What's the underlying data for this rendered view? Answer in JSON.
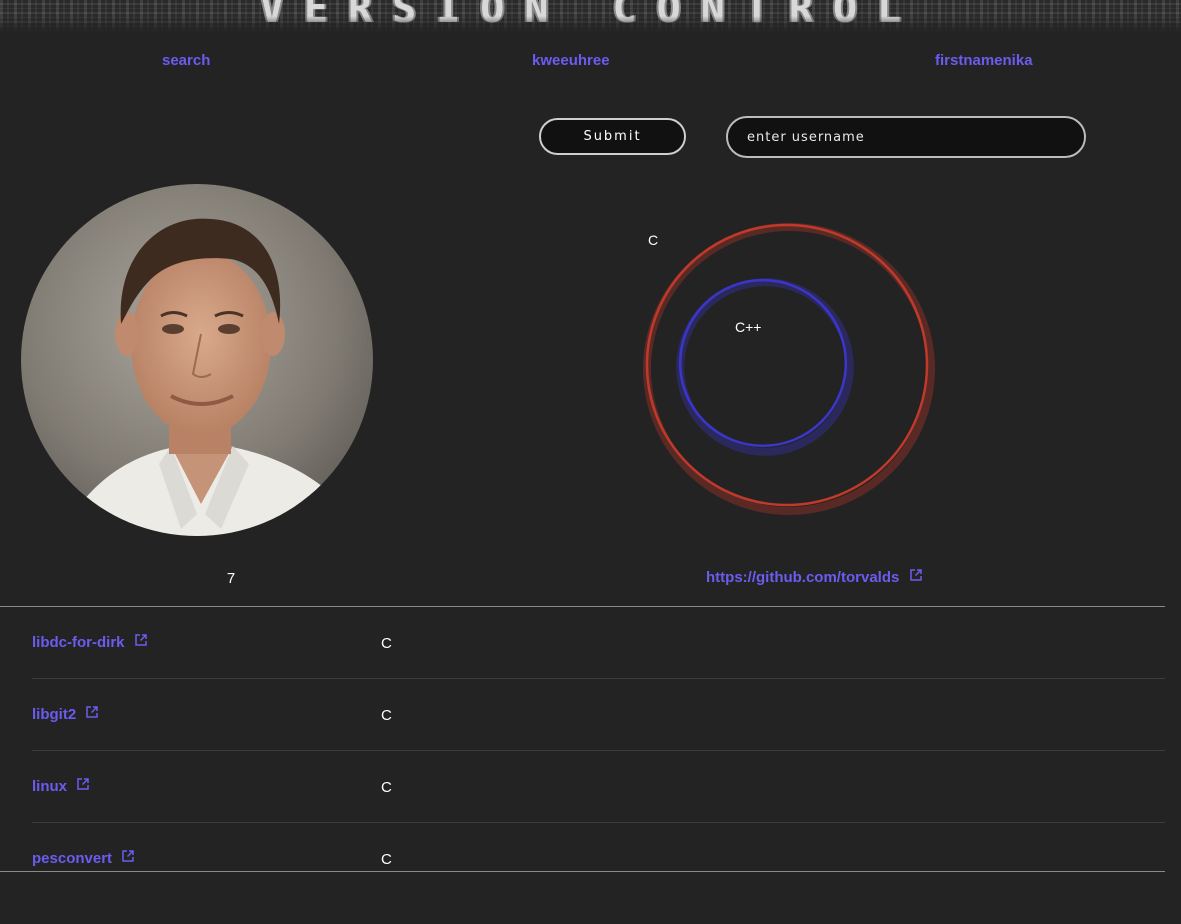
{
  "banner": {
    "title": "VERSION CONTROL"
  },
  "nav": {
    "items": [
      {
        "label": "search"
      },
      {
        "label": "kweeuhree"
      },
      {
        "label": "firstnamenika"
      }
    ]
  },
  "form": {
    "submit_label": "Submit",
    "username_placeholder": "enter username",
    "username_value": ""
  },
  "profile": {
    "repo_count": "7",
    "url": "https://github.com/torvalds"
  },
  "chart_data": {
    "type": "bubble",
    "series": [
      {
        "name": "C",
        "relative_size": 1.0,
        "color": "#c0392b"
      },
      {
        "name": "C++",
        "relative_size": 0.35,
        "color": "#3b36c9"
      }
    ]
  },
  "repos": [
    {
      "name": "libdc-for-dirk",
      "language": "C"
    },
    {
      "name": "libgit2",
      "language": "C"
    },
    {
      "name": "linux",
      "language": "C"
    },
    {
      "name": "pesconvert",
      "language": "C"
    }
  ],
  "icons": {
    "external_link": "external-link-icon"
  },
  "colors": {
    "background": "#232323",
    "link": "#6b5cf0",
    "c_bubble": "#c0392b",
    "cpp_bubble": "#3b36c9"
  }
}
